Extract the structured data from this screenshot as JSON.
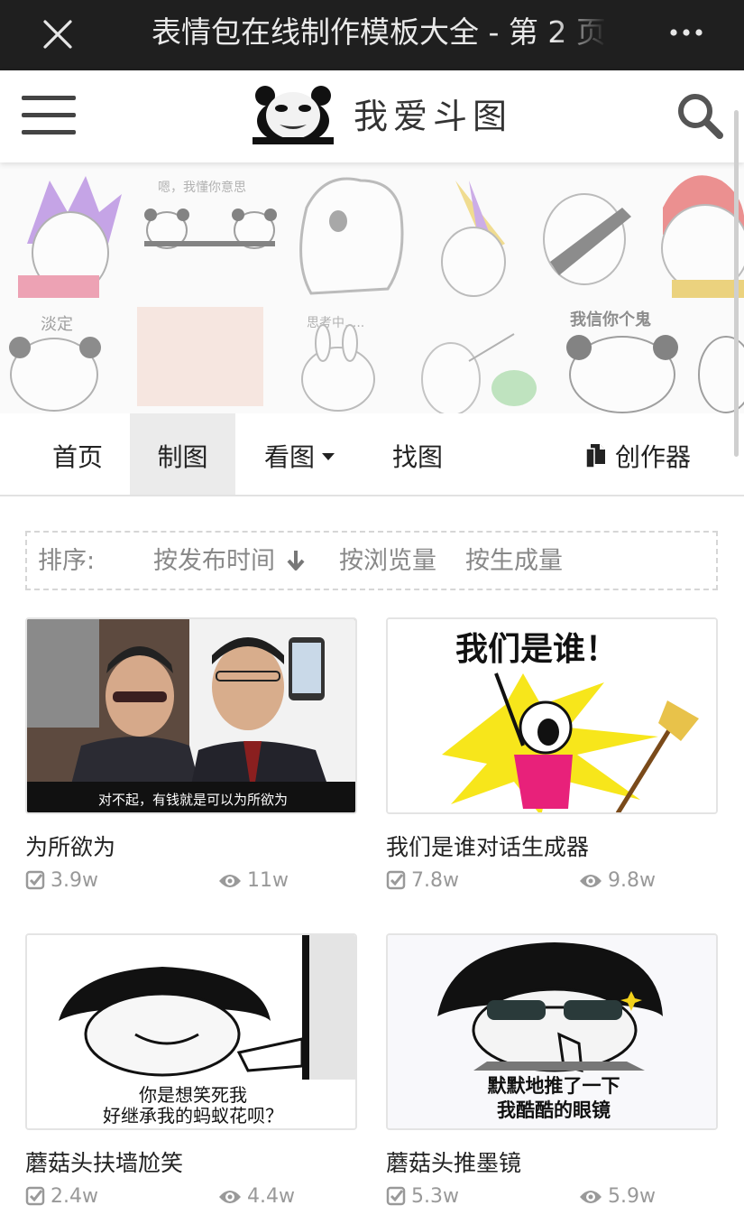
{
  "window": {
    "title": "表情包在线制作模板大全 - 第 2 页",
    "close_icon": "close-icon",
    "more_icon": "more-icon"
  },
  "header": {
    "brand": "我爱斗图",
    "menu_icon": "hamburger-icon",
    "logo_icon": "panda-logo-icon",
    "search_icon": "search-icon"
  },
  "banner": {
    "captions": [
      "嗯，我懂你意思",
      "淡定",
      "思考中.....",
      "我信你个鬼"
    ]
  },
  "nav": {
    "items": [
      {
        "label": "首页"
      },
      {
        "label": "制图"
      },
      {
        "label": "看图"
      },
      {
        "label": "找图"
      }
    ],
    "creator_label": "创作器",
    "active": "制图"
  },
  "sort": {
    "label": "排序:",
    "by_time": "按发布时间",
    "by_views": "按浏览量",
    "by_generated": "按生成量"
  },
  "cards": [
    {
      "title": "为所欲为",
      "made": "3.9w",
      "views": "11w",
      "caption": "对不起，有钱就是可以为所欲为"
    },
    {
      "title": "我们是谁对话生成器",
      "made": "7.8w",
      "views": "9.8w",
      "caption": "我们是谁！"
    },
    {
      "title": "蘑菇头扶墙尬笑",
      "made": "2.4w",
      "views": "4.4w",
      "caption": "你是想笑死我\n好继承我的蚂蚁花呗？",
      "caption_line1": "你是想笑死我",
      "caption_line2": "好继承我的蚂蚁花呗？"
    },
    {
      "title": "蘑菇头推墨镜",
      "made": "5.3w",
      "views": "5.9w",
      "caption": "默默地推了一下\n我酷酷的眼镜",
      "caption_line1": "默默地推了一下",
      "caption_line2": "我酷酷的眼镜"
    }
  ],
  "colors": {
    "topbar_bg": "#1f1f1f",
    "nav_active_bg": "#ebebeb",
    "meme_yellow": "#f7e61b",
    "meme_pink": "#e8217a"
  }
}
